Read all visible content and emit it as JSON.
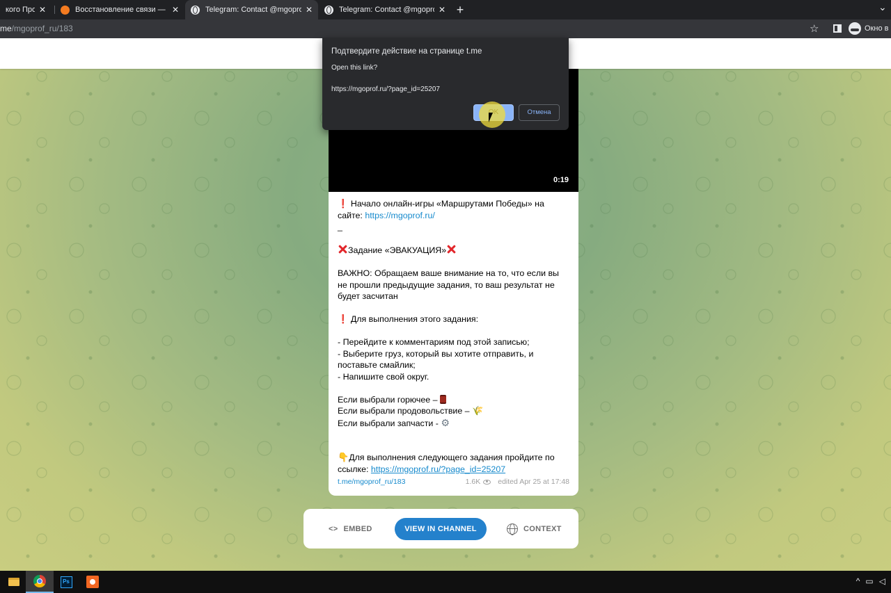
{
  "browser": {
    "tabs": [
      {
        "title": "кого Профсо",
        "favicon": "partial"
      },
      {
        "title": "Восстановление связи — МГО С",
        "favicon": "orange-circle-icon"
      },
      {
        "title": "Telegram: Contact @mgoprof_ru",
        "favicon": "globe-icon",
        "active": true
      },
      {
        "title": "Telegram: Contact @mgoprof_ru",
        "favicon": "globe-icon"
      }
    ],
    "tab_close": "✕",
    "new_tab": "+",
    "url_prefix": "me",
    "url_path": "/mgoprof_ru/183",
    "profile_label": "Окно в р"
  },
  "dialog": {
    "title": "Подтвердите действие на странице t.me",
    "question": "Open this link?",
    "url": "https://mgoprof.ru/?page_id=25207",
    "ok_label": "OK",
    "cancel_label": "Отмена"
  },
  "post": {
    "duration": "0:19",
    "line1a": "Начало онлайн-игры «Маршрутами Победы» на сайте: ",
    "link1": "https://mgoprof.ru/",
    "dash": "_",
    "task": "Задание «ЭВАКУАЦИЯ»",
    "important": "ВАЖНО: Обращаем ваше внимание на то, что если вы не прошли предыдущие задания, то ваш результат не будет засчитан",
    "instr_title": "Для выполнения этого задания:",
    "steps": [
      "- Перейдите к комментариям под этой записью;",
      "- Выберите груз, который вы хотите отправить, и поставьте смайлик;",
      "- Напишите свой округ."
    ],
    "choices": [
      "Если выбрали горючее – ",
      "Если выбрали продовольствие – ",
      "Если выбрали запчасти - "
    ],
    "next_text": "Для выполнения следующего задания пройдите по ссылке: ",
    "link2": "https://mgoprof.ru/?page_id=25207",
    "meta_link": "t.me/mgoprof_ru/183",
    "views": "1.6K",
    "edited": "edited  Apr 25 at 17:48"
  },
  "actions": {
    "embed": "EMBED",
    "embed_icon": "<>",
    "view": "VIEW IN CHANNEL",
    "context": "CONTEXT"
  },
  "colors": {
    "accent": "#2481cc",
    "link": "#168acd",
    "dialog_bg": "#292a2d"
  }
}
